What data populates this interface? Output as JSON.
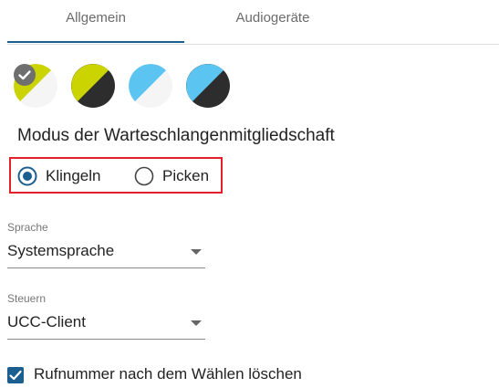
{
  "tabs": [
    {
      "label": "Allgemein",
      "active": true
    },
    {
      "label": "Audiogeräte",
      "active": false
    }
  ],
  "themes": [
    {
      "name": "lime-white",
      "colors": [
        "#cbd300",
        "#f5f5f5"
      ],
      "selected": true
    },
    {
      "name": "lime-dark",
      "colors": [
        "#cbd300",
        "#2d2d2d"
      ],
      "selected": false
    },
    {
      "name": "blue-white",
      "colors": [
        "#5bc4f0",
        "#f5f5f5"
      ],
      "selected": false
    },
    {
      "name": "blue-dark",
      "colors": [
        "#5bc4f0",
        "#2d2d2d"
      ],
      "selected": false
    }
  ],
  "queue_mode": {
    "title": "Modus der Warteschlangenmitgliedschaft",
    "options": [
      {
        "label": "Klingeln",
        "checked": true
      },
      {
        "label": "Picken",
        "checked": false
      }
    ]
  },
  "language": {
    "label": "Sprache",
    "value": "Systemsprache"
  },
  "control": {
    "label": "Steuern",
    "value": "UCC-Client"
  },
  "clear_number": {
    "label": "Rufnummer nach dem Wählen löschen",
    "checked": true
  },
  "colors": {
    "accent": "#1a5f8f",
    "highlight_border": "#e0202a"
  }
}
